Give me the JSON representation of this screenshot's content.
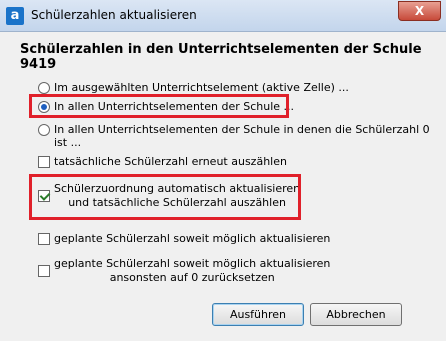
{
  "window": {
    "title": "Schülerzahlen aktualisieren",
    "app_icon_letter": "a",
    "close_glyph": "X"
  },
  "heading": "Schülerzahlen in den Unterrichtselementen der Schule 9419",
  "scope_options": [
    {
      "label": "Im ausgewählten Unterrichtselement (aktive Zelle) ...",
      "selected": false
    },
    {
      "label": "In allen Unterrichtselementen der Schule ...",
      "selected": true
    },
    {
      "label": "In allen Unterrichtselementen der Schule in denen die Schülerzahl 0 ist ...",
      "selected": false
    }
  ],
  "checkboxes": [
    {
      "label": "tatsächliche Schülerzahl erneut auszählen",
      "checked": false
    },
    {
      "line1": "Schülerzuordnung automatisch aktualisieren",
      "line2": "und tatsächliche Schülerzahl auszählen",
      "checked": true
    },
    {
      "label": "geplante Schülerzahl soweit möglich aktualisieren",
      "checked": false
    },
    {
      "line1": "geplante Schülerzahl soweit möglich aktualisieren",
      "line2": "ansonsten auf 0 zurücksetzen",
      "checked": false
    }
  ],
  "buttons": {
    "execute": "Ausführen",
    "cancel": "Abbrechen"
  },
  "colors": {
    "highlight": "#e0202a",
    "titlebar": "#c3d5ec"
  }
}
